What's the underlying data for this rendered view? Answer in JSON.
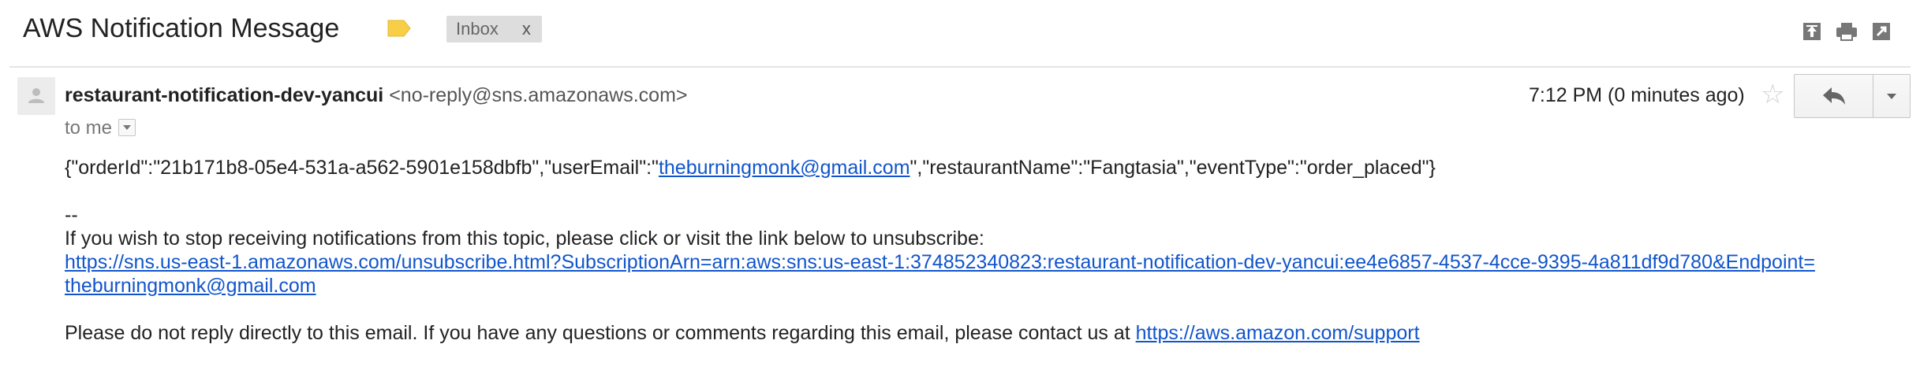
{
  "header": {
    "subject": "AWS Notification Message",
    "label_icon": "label-tag-icon",
    "inbox_chip": {
      "label": "Inbox",
      "remove": "x"
    },
    "actions": [
      "new-window-icon",
      "print-icon",
      "expand-icon"
    ]
  },
  "message": {
    "sender_name": "restaurant-notification-dev-yancui",
    "sender_email": "<no-reply@sns.amazonaws.com>",
    "to_text": "to me",
    "timestamp": "7:12 PM (0 minutes ago)",
    "star_icon": "star-icon",
    "reply_icon": "reply-icon",
    "more_icon": "chevron-down-icon"
  },
  "body": {
    "json_prefix": "{\"orderId\":\"21b171b8-05e4-531a-a562-5901e158dbfb\",\"userEmail\":\"",
    "json_email": "theburningmonk@gmail.com",
    "json_suffix": "\",\"restaurantName\":\"Fangtasia\",\"eventType\":\"order_placed\"}",
    "separator": "--",
    "unsubscribe_text": "If you wish to stop receiving notifications from this topic, please click or visit the link below to unsubscribe:",
    "unsubscribe_link_line1": "https://sns.us-east-1.amazonaws.com/unsubscribe.html?SubscriptionArn=arn:aws:sns:us-east-1:374852340823:restaurant-notification-dev-yancui:ee4e6857-4537-4cce-9395-4a811df9d780&Endpoint=",
    "unsubscribe_link_line2": "theburningmonk@gmail.com",
    "footer_text": "Please do not reply directly to this email. If you have any questions or comments regarding this email, please contact us at ",
    "footer_link": "https://aws.amazon.com/support"
  },
  "colors": {
    "link": "#1155cc",
    "label_tag": "#f7ce46",
    "chip_bg": "#dddddd"
  }
}
